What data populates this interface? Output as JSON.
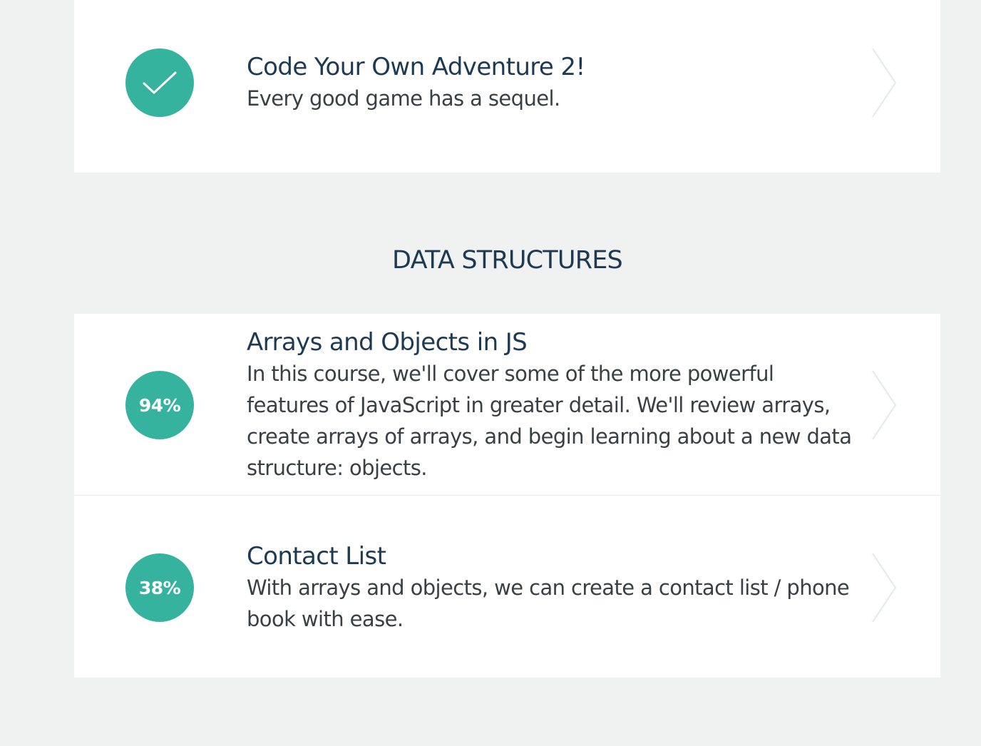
{
  "courses_before": [
    {
      "status": "complete",
      "badge_icon": "checkmark-icon",
      "title": "Code Your Own Adventure 2!",
      "description": "Every good game has a sequel."
    }
  ],
  "section": {
    "heading": "DATA STRUCTURES"
  },
  "courses": [
    {
      "progress_label": "94%",
      "progress": 0.94,
      "title": "Arrays and Objects in JS",
      "description": "In this course, we'll cover some of the more powerful features of JavaScript in greater detail. We'll review arrays, create arrays of arrays, and begin learning about a new data structure: objects."
    },
    {
      "progress_label": "38%",
      "progress": 0.38,
      "title": "Contact List",
      "description": "With arrays and objects, we can create a contact list / phone book with ease."
    }
  ],
  "colors": {
    "accent": "#36b39f",
    "background": "#f0f1f1",
    "card": "#ffffff",
    "title_text": "#1e3a52",
    "body_text": "#3a3f43",
    "chevron": "#e3e8ea"
  },
  "icons": {
    "chevron": "chevron-right-icon",
    "check": "checkmark-icon"
  }
}
